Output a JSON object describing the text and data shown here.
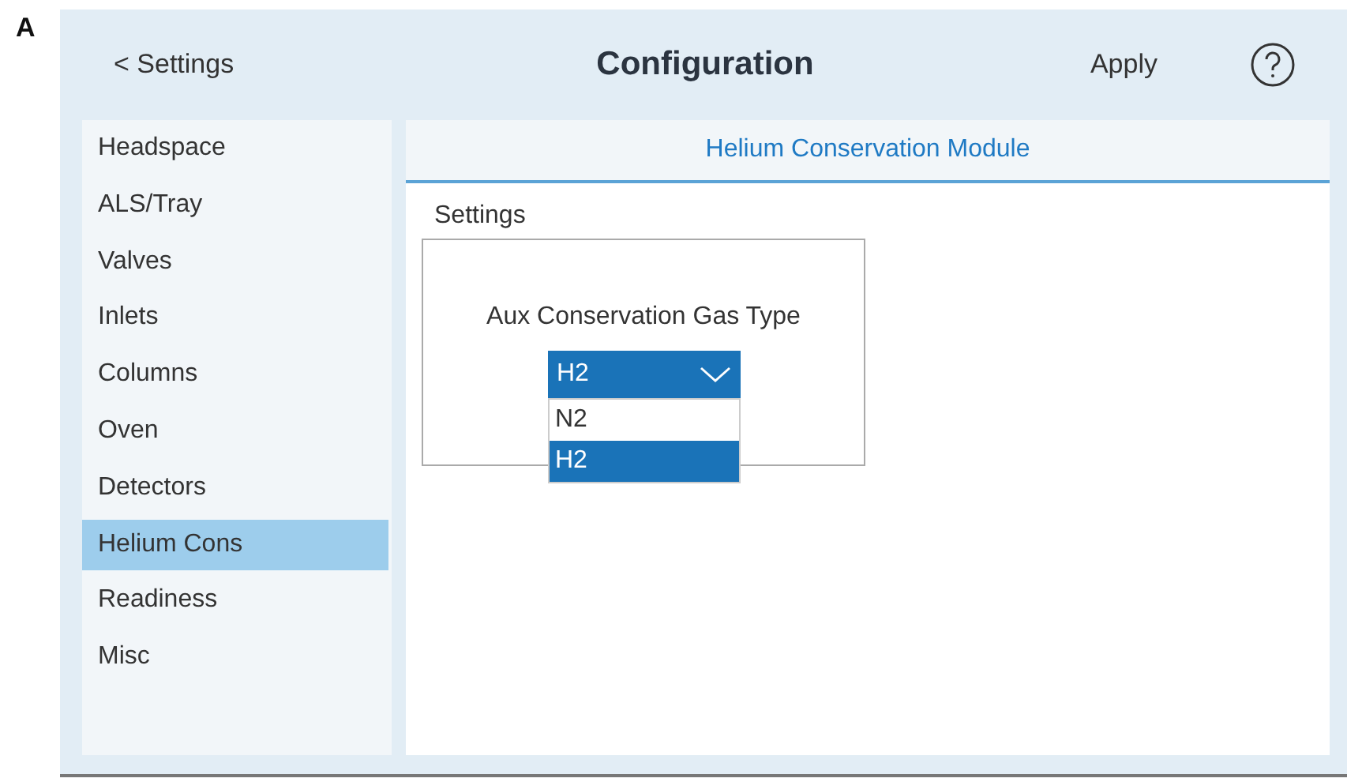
{
  "figure_label": "A",
  "header": {
    "back": "< Settings",
    "title": "Configuration",
    "apply": "Apply"
  },
  "sidebar": {
    "items": [
      {
        "label": "Headspace",
        "selected": false
      },
      {
        "label": "ALS/Tray",
        "selected": false
      },
      {
        "label": "Valves",
        "selected": false
      },
      {
        "label": "Inlets",
        "selected": false
      },
      {
        "label": "Columns",
        "selected": false
      },
      {
        "label": "Oven",
        "selected": false
      },
      {
        "label": "Detectors",
        "selected": false
      },
      {
        "label": "Helium Cons",
        "selected": true
      },
      {
        "label": "Readiness",
        "selected": false
      },
      {
        "label": "Misc",
        "selected": false
      }
    ]
  },
  "panel": {
    "title": "Helium Conservation Module",
    "section": "Settings",
    "field_label": "Aux Conservation Gas Type",
    "select": {
      "value": "H2",
      "expanded": true,
      "options": [
        {
          "label": "N2",
          "selected": false
        },
        {
          "label": "H2",
          "selected": true
        }
      ]
    }
  }
}
